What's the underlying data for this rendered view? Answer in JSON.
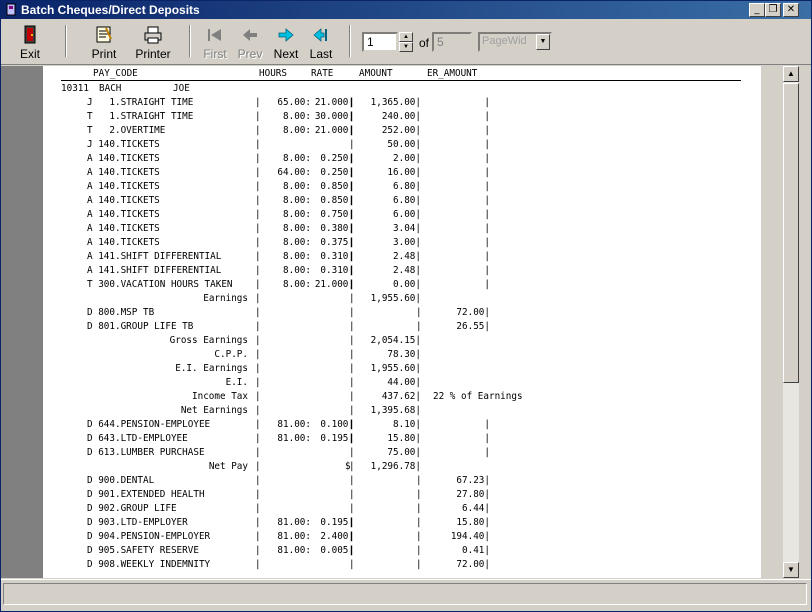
{
  "window": {
    "title": "Batch Cheques/Direct Deposits"
  },
  "toolbar": {
    "exit": "Exit",
    "print": "Print",
    "printer": "Printer",
    "first": "First",
    "prev": "Prev",
    "next": "Next",
    "last": "Last",
    "page_current": "1",
    "of_label": "of",
    "page_total": "5",
    "zoom": "PageWid"
  },
  "report": {
    "headers": {
      "pay_code": "PAY_CODE",
      "hours": "HOURS",
      "rate": "RATE",
      "amount": "AMOUNT",
      "er_amount": "ER_AMOUNT"
    },
    "employee": {
      "id": "10311",
      "last": "BACH",
      "first": "JOE"
    },
    "rows": [
      {
        "code": "J   1.STRAIGHT TIME",
        "hours": "65.00",
        "rate": "21.000",
        "amount": "1,365.00",
        "er": "",
        "sep": "|"
      },
      {
        "code": "T   1.STRAIGHT TIME",
        "hours": "8.00",
        "rate": "30.000",
        "amount": "240.00",
        "er": "",
        "sep": "|"
      },
      {
        "code": "T   2.OVERTIME",
        "hours": "8.00",
        "rate": "21.000",
        "amount": "252.00",
        "er": "",
        "sep": "|"
      },
      {
        "code": "J 140.TICKETS",
        "hours": "",
        "rate": "",
        "amount": "50.00",
        "er": "",
        "sep": "|"
      },
      {
        "code": "A 140.TICKETS",
        "hours": "8.00",
        "rate": "0.250",
        "amount": "2.00",
        "er": "",
        "sep": "|"
      },
      {
        "code": "A 140.TICKETS",
        "hours": "64.00",
        "rate": "0.250",
        "amount": "16.00",
        "er": "",
        "sep": "|"
      },
      {
        "code": "A 140.TICKETS",
        "hours": "8.00",
        "rate": "0.850",
        "amount": "6.80",
        "er": "",
        "sep": "|"
      },
      {
        "code": "A 140.TICKETS",
        "hours": "8.00",
        "rate": "0.850",
        "amount": "6.80",
        "er": "",
        "sep": "|"
      },
      {
        "code": "A 140.TICKETS",
        "hours": "8.00",
        "rate": "0.750",
        "amount": "6.00",
        "er": "",
        "sep": "|"
      },
      {
        "code": "A 140.TICKETS",
        "hours": "8.00",
        "rate": "0.380",
        "amount": "3.04",
        "er": "",
        "sep": "|"
      },
      {
        "code": "A 140.TICKETS",
        "hours": "8.00",
        "rate": "0.375",
        "amount": "3.00",
        "er": "",
        "sep": "|"
      },
      {
        "code": "A 141.SHIFT DIFFERENTIAL",
        "hours": "8.00",
        "rate": "0.310",
        "amount": "2.48",
        "er": "",
        "sep": "|"
      },
      {
        "code": "A 141.SHIFT DIFFERENTIAL",
        "hours": "8.00",
        "rate": "0.310",
        "amount": "2.48",
        "er": "",
        "sep": "|"
      },
      {
        "code": "T 300.VACATION HOURS TAKEN",
        "hours": "8.00",
        "rate": "21.000",
        "amount": "0.00",
        "er": "",
        "sep": "|"
      },
      {
        "label": "Earnings",
        "amount": "1,955.60",
        "er": "",
        "sep": ""
      },
      {
        "code": "D 800.MSP TB",
        "hours": "",
        "rate": "",
        "amount": "",
        "er": "72.00",
        "sep": "|"
      },
      {
        "code": "D 801.GROUP LIFE TB",
        "hours": "",
        "rate": "",
        "amount": "",
        "er": "26.55",
        "sep": "|"
      },
      {
        "label": "Gross Earnings",
        "amount": "2,054.15",
        "er": "",
        "sep": ""
      },
      {
        "label": "C.P.P.",
        "amount": "78.30",
        "er": "",
        "sep": ""
      },
      {
        "label": "E.I. Earnings",
        "amount": "1,955.60",
        "er": "",
        "sep": ""
      },
      {
        "label": "E.I.",
        "amount": "44.00",
        "er": "",
        "sep": ""
      },
      {
        "label": "Income Tax",
        "amount": "437.62",
        "er": "",
        "note": "22 % of Earnings",
        "sep": ""
      },
      {
        "label": "Net Earnings",
        "amount": "1,395.68",
        "er": "",
        "sep": ""
      },
      {
        "code": "D 644.PENSION-EMPLOYEE",
        "hours": "81.00",
        "rate": "0.100",
        "amount": "8.10",
        "er": "",
        "sep": "|"
      },
      {
        "code": "D 643.LTD-EMPLOYEE",
        "hours": "81.00",
        "rate": "0.195",
        "amount": "15.80",
        "er": "",
        "sep": "|"
      },
      {
        "code": "D 613.LUMBER PURCHASE",
        "hours": "",
        "rate": "",
        "amount": "75.00",
        "er": "",
        "sep": "|"
      },
      {
        "label": "Net Pay",
        "amount": "1,296.78",
        "er": "",
        "dollar": "$",
        "sep": ""
      },
      {
        "code": "D 900.DENTAL",
        "hours": "",
        "rate": "",
        "amount": "",
        "er": "67.23",
        "sep": "|"
      },
      {
        "code": "D 901.EXTENDED HEALTH",
        "hours": "",
        "rate": "",
        "amount": "",
        "er": "27.80",
        "sep": "|"
      },
      {
        "code": "D 902.GROUP LIFE",
        "hours": "",
        "rate": "",
        "amount": "",
        "er": "6.44",
        "sep": "|"
      },
      {
        "code": "D 903.LTD-EMPLOYER",
        "hours": "81.00",
        "rate": "0.195",
        "amount": "",
        "er": "15.80",
        "sep": "|"
      },
      {
        "code": "D 904.PENSION-EMPLOYER",
        "hours": "81.00",
        "rate": "2.400",
        "amount": "",
        "er": "194.40",
        "sep": "|"
      },
      {
        "code": "D 905.SAFETY RESERVE",
        "hours": "81.00",
        "rate": "0.005",
        "amount": "",
        "er": "0.41",
        "sep": "|"
      },
      {
        "code": "D 908.WEEKLY INDEMNITY",
        "hours": "",
        "rate": "",
        "amount": "",
        "er": "72.00",
        "sep": "|"
      }
    ]
  }
}
